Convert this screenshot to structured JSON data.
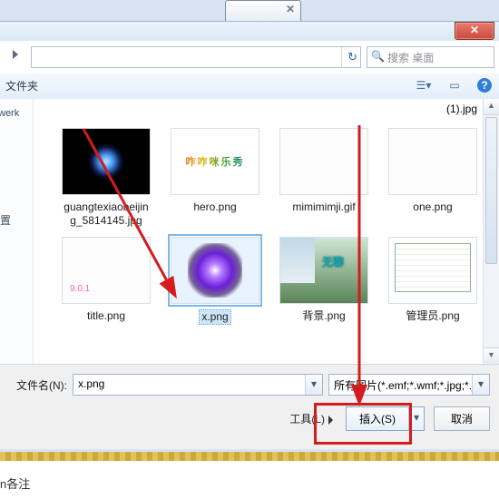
{
  "ghost_close": "✕",
  "titlebar_close": "✕",
  "nav": {
    "refresh_glyph": "↻",
    "search_glyph": "🔍",
    "search_placeholder": "搜索 桌面"
  },
  "toolbar": {
    "left_label": "文件夹",
    "help_glyph": "?"
  },
  "sidebar": {
    "peek1": "werk",
    "peek2": "置"
  },
  "top_right_prev": "(1).jpg",
  "files": [
    {
      "name": "guangtexiaobeijing_5814145.jpg",
      "thumb": "starblue"
    },
    {
      "name": "hero.png",
      "thumb": "hero",
      "txt": "咋咋咪乐秀"
    },
    {
      "name": "mimimimji.gif",
      "thumb": "blank"
    },
    {
      "name": "one.png",
      "thumb": "blank"
    },
    {
      "name": "title.png",
      "thumb": "title",
      "txt": "9.0.1"
    },
    {
      "name": "x.png",
      "thumb": "purple",
      "selected": true
    },
    {
      "name": "背景.png",
      "thumb": "bg",
      "txt": "无聊"
    },
    {
      "name": "管理员.png",
      "thumb": "xls"
    }
  ],
  "footer": {
    "filename_label": "文件名(N):",
    "filename_value": "x.png",
    "filter_text": "所有图片(*.emf;*.wmf;*.jpg;*.jpeg;*.png;*.gif)",
    "tools_label": "工具(L)",
    "insert_label": "插入(S)",
    "cancel_label": "取消",
    "dd_glyph": "▾",
    "tri_glyph": "▸"
  },
  "bottom_fragment": "n各注"
}
